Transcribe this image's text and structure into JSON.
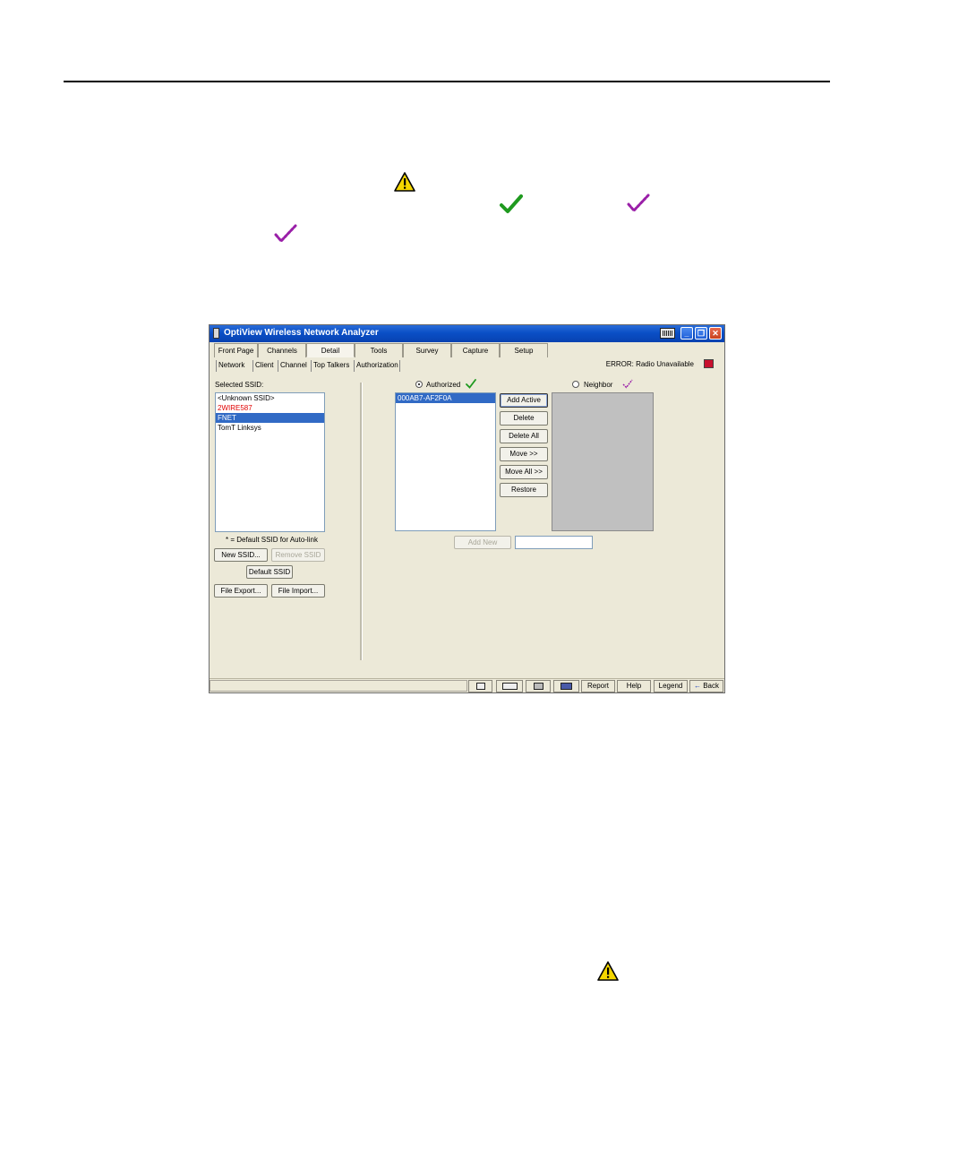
{
  "window": {
    "title": "OptiView Wireless Network Analyzer",
    "title_buttons": {
      "minimize": "_",
      "restore": "❐",
      "close": "✕"
    }
  },
  "main_tabs": [
    {
      "label": "Front Page"
    },
    {
      "label": "Channels"
    },
    {
      "label": "Detail"
    },
    {
      "label": "Tools"
    },
    {
      "label": "Survey"
    },
    {
      "label": "Capture"
    },
    {
      "label": "Setup"
    }
  ],
  "main_tab_active": "Detail",
  "sub_tabs": [
    {
      "label": "Network"
    },
    {
      "label": "Client"
    },
    {
      "label": "Channel"
    },
    {
      "label": "Top Talkers"
    },
    {
      "label": "Authorization"
    }
  ],
  "sub_tab_active": "Authorization",
  "error_status": "ERROR: Radio Unavailable",
  "ssid_panel": {
    "label": "Selected SSID:",
    "items": [
      {
        "text": "<Unknown SSID>",
        "style": "normal"
      },
      {
        "text": "2WIRE587",
        "style": "red"
      },
      {
        "text": "FNET",
        "style": "selected"
      },
      {
        "text": "TomT Linksys",
        "style": "normal"
      }
    ],
    "note": "* = Default SSID for Auto-link",
    "buttons": {
      "new_ssid": "New SSID...",
      "remove_ssid": "Remove SSID",
      "default_ssid": "Default SSID",
      "file_export": "File Export...",
      "file_import": "File Import..."
    }
  },
  "authorization": {
    "authorized_label": "Authorized",
    "neighbor_label": "Neighbor",
    "authorized_selected": true,
    "authorized_list": [
      "000AB7-AF2F0A"
    ],
    "buttons": {
      "add_active": "Add Active",
      "delete": "Delete",
      "delete_all": "Delete All",
      "move": "Move >>",
      "move_all": "Move All >>",
      "restore": "Restore",
      "add_new": "Add New"
    },
    "add_new_value": ""
  },
  "status_bar": {
    "report": "Report",
    "help": "Help",
    "legend": "Legend",
    "back": "Back",
    "back_arrow": "←"
  },
  "colors": {
    "title_bar": "#0a4fc6",
    "selection": "#316ac5",
    "ssid_red": "#e00000",
    "check_green": "#1f9a1f",
    "check_purple": "#9a1fa8",
    "warning_yellow": "#f4d600"
  }
}
